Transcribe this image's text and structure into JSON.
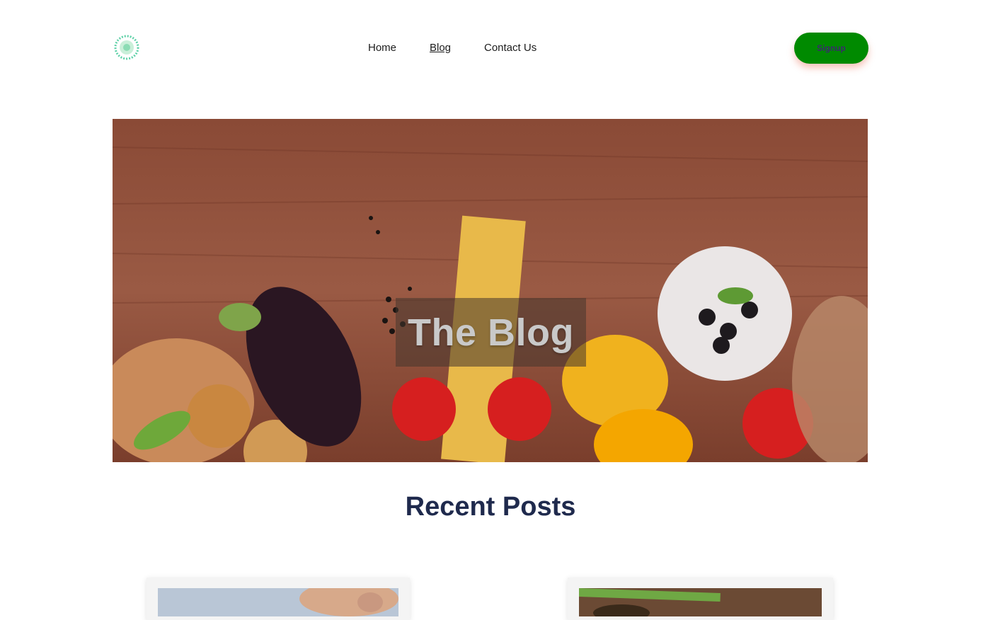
{
  "header": {
    "logo_icon": "circular-badge-logo",
    "nav": {
      "home": "Home",
      "blog": "Blog",
      "contact": "Contact Us"
    },
    "signup_label": "Signup"
  },
  "hero": {
    "title": "The Blog",
    "image": "vegetables-on-wooden-table"
  },
  "recent": {
    "title": "Recent Posts"
  },
  "colors": {
    "signup_bg": "#008a00",
    "signup_text": "#3a2a6e",
    "section_title": "#1f2a4d"
  }
}
